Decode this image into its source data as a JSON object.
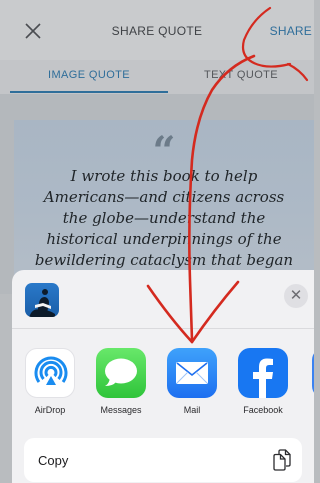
{
  "header": {
    "title": "SHARE QUOTE",
    "share_label": "SHARE"
  },
  "tabs": [
    {
      "label": "IMAGE QUOTE",
      "selected": true
    },
    {
      "label": "TEXT QUOTE",
      "selected": false
    }
  ],
  "quote": {
    "mark": "“",
    "lines": [
      "I wrote this book to help",
      "Americans—and citizens across",
      "the globe—understand the",
      "historical underpinnings of the",
      "bewildering cataclysm that began"
    ]
  },
  "share_sheet": {
    "apps": [
      {
        "label": "AirDrop",
        "icon": "airdrop-icon"
      },
      {
        "label": "Messages",
        "icon": "messages-icon"
      },
      {
        "label": "Mail",
        "icon": "mail-icon"
      },
      {
        "label": "Facebook",
        "icon": "facebook-icon"
      }
    ],
    "copy_label": "Copy"
  },
  "colors": {
    "accent": "#2f6e9a",
    "annotation": "#d42a1f",
    "mail_blue": "#1d6ff0",
    "messages_green": "#2fc43a",
    "facebook_blue": "#1877f2"
  }
}
